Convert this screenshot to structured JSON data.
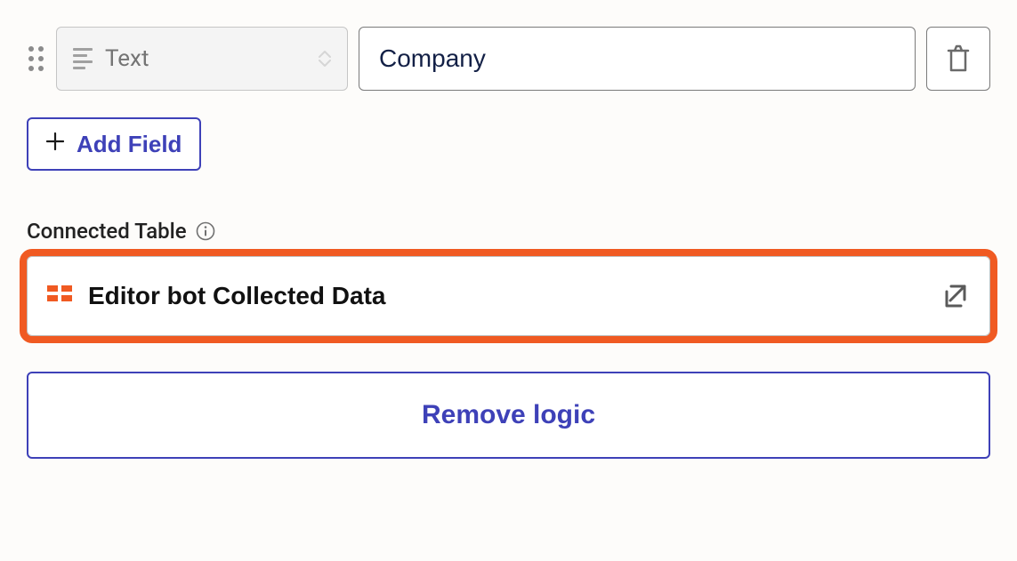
{
  "field": {
    "type_label": "Text",
    "name_value": "Company"
  },
  "buttons": {
    "add_field": "Add Field",
    "remove_logic": "Remove logic"
  },
  "sections": {
    "connected_table_label": "Connected Table",
    "connected_table_name": "Editor bot Collected Data"
  }
}
